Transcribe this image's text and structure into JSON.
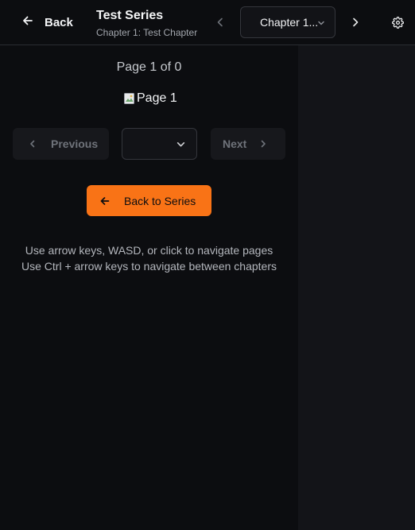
{
  "header": {
    "back_label": "Back",
    "series_title": "Test Series",
    "chapter_subtitle": "Chapter 1: Test Chapter",
    "chapter_select_value": "Chapter 1...",
    "icons": {
      "back": "arrow-left-icon",
      "prev_chapter": "chevron-left-icon",
      "chapter_dropdown": "chevron-down-icon",
      "next_chapter": "chevron-right-icon",
      "settings": "gear-icon"
    }
  },
  "reader": {
    "page_indicator": "Page 1 of 0",
    "page_image_alt": "Page 1",
    "previous_label": "Previous",
    "next_label": "Next",
    "page_select_value": "",
    "back_to_series_label": "Back to Series",
    "help_line_1": "Use arrow keys, WASD, or click to navigate pages",
    "help_line_2": "Use Ctrl + arrow keys to navigate between chapters"
  },
  "colors": {
    "accent": "#f97316",
    "background": "#0c0d10",
    "panel": "#131418"
  }
}
